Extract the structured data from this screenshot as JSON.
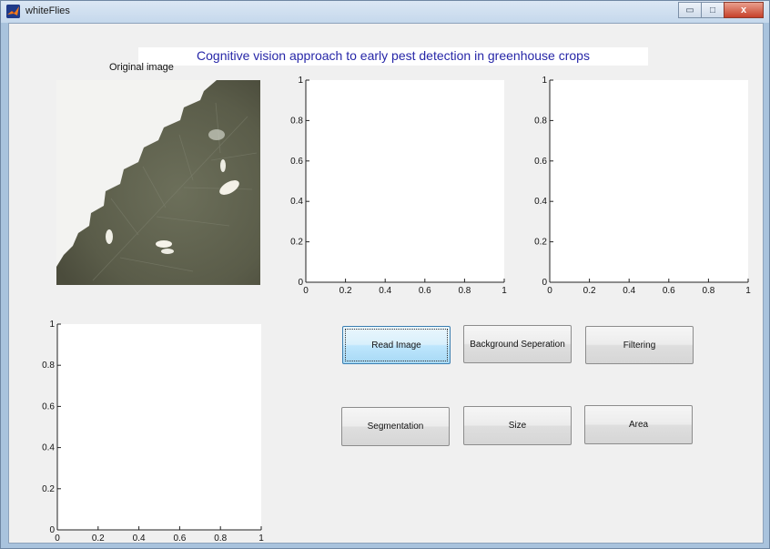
{
  "window": {
    "title": "whiteFlies",
    "minimize_glyph": "▭",
    "maximize_glyph": "□",
    "close_glyph": "x"
  },
  "header": {
    "text": "Cognitive vision approach to early pest detection in greenhouse crops",
    "color": "#2727a8"
  },
  "original_image": {
    "label": "Original image"
  },
  "axes": [
    {
      "id": "axes-top-middle",
      "xticks": [
        "0",
        "0.2",
        "0.4",
        "0.6",
        "0.8",
        "1"
      ],
      "yticks": [
        "0",
        "0.2",
        "0.4",
        "0.6",
        "0.8",
        "1"
      ],
      "xlim": [
        0,
        1
      ],
      "ylim": [
        0,
        1
      ]
    },
    {
      "id": "axes-top-right",
      "xticks": [
        "0",
        "0.2",
        "0.4",
        "0.6",
        "0.8",
        "1"
      ],
      "yticks": [
        "0",
        "0.2",
        "0.4",
        "0.6",
        "0.8",
        "1"
      ],
      "xlim": [
        0,
        1
      ],
      "ylim": [
        0,
        1
      ]
    },
    {
      "id": "axes-bottom-left",
      "xticks": [
        "0",
        "0.2",
        "0.4",
        "0.6",
        "0.8",
        "1"
      ],
      "yticks": [
        "0",
        "0.2",
        "0.4",
        "0.6",
        "0.8",
        "1"
      ],
      "xlim": [
        0,
        1
      ],
      "ylim": [
        0,
        1
      ]
    }
  ],
  "buttons": {
    "read_image": "Read Image",
    "background_separation": "Background Seperation",
    "filtering": "Filtering",
    "segmentation": "Segmentation",
    "size": "Size",
    "area": "Area"
  }
}
